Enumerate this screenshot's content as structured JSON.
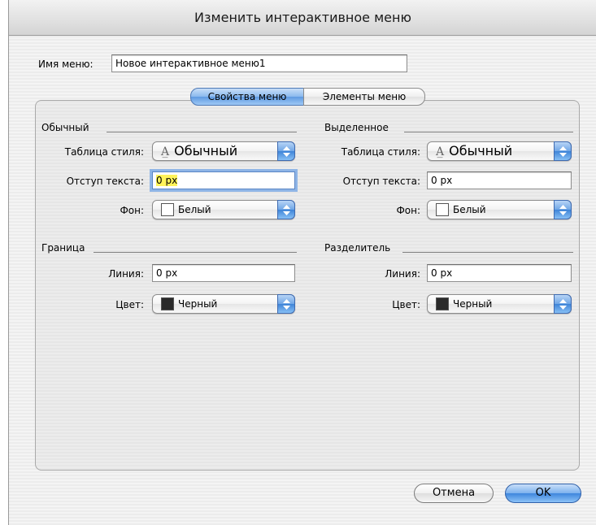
{
  "window": {
    "title": "Изменить интерактивное меню"
  },
  "menu_name": {
    "label": "Имя меню:",
    "value": "Новое интерактивное меню1"
  },
  "tabs": [
    {
      "label": "Свойства меню",
      "selected": true
    },
    {
      "label": "Элементы меню",
      "selected": false
    }
  ],
  "normal": {
    "title": "Обычный",
    "style_label": "Таблица стиля:",
    "style_value": "Обычный",
    "indent_label": "Отступ текста:",
    "indent_value": "0 px",
    "bg_label": "Фон:",
    "bg_value": "Белый",
    "bg_color": "#ffffff"
  },
  "highlighted": {
    "title": "Выделенное",
    "style_label": "Таблица стиля:",
    "style_value": "Обычный",
    "indent_label": "Отступ текста:",
    "indent_value": "0 px",
    "bg_label": "Фон:",
    "bg_value": "Белый",
    "bg_color": "#ffffff"
  },
  "border": {
    "title": "Граница",
    "line_label": "Линия:",
    "line_value": "0 px",
    "color_label": "Цвет:",
    "color_value": "Черный",
    "color_hex": "#2a2a2a"
  },
  "separator": {
    "title": "Разделитель",
    "line_label": "Линия:",
    "line_value": "0 px",
    "color_label": "Цвет:",
    "color_value": "Черный",
    "color_hex": "#2a2a2a"
  },
  "buttons": {
    "cancel": "Отмена",
    "ok": "OK"
  },
  "style_glyph": "A̲"
}
